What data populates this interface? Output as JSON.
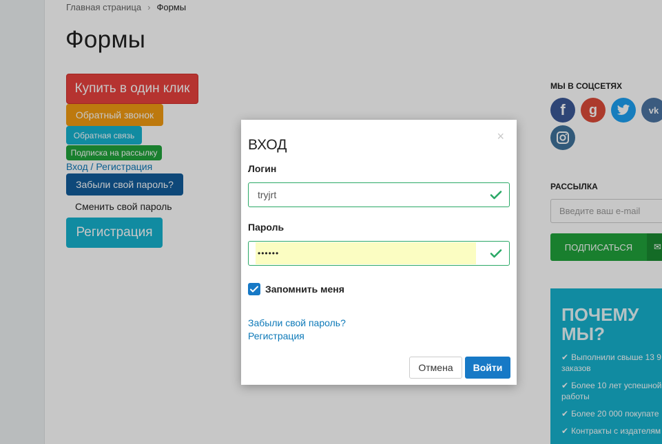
{
  "breadcrumb": {
    "home": "Главная страница",
    "separator": "›",
    "current": "Формы"
  },
  "page_title": "Формы",
  "buttons": {
    "buy_one_click": "Купить в один клик",
    "callback": "Обратный звонок",
    "feedback": "Обратная связь",
    "newsletter": "Подписка на рассылку",
    "login_register": "Вход / Регистрация",
    "forgot_password": "Забыли свой пароль?",
    "change_password": "Сменить свой пароль",
    "register": "Регистрация"
  },
  "sidebar": {
    "social_title": "МЫ В СОЦСЕТЯХ",
    "social": [
      {
        "name": "facebook-icon",
        "glyph": "f",
        "color": "#3b5998"
      },
      {
        "name": "google-plus-icon",
        "glyph": "g",
        "color": "#dd4b39"
      },
      {
        "name": "twitter-icon",
        "glyph": "t",
        "color": "#1da1f2"
      },
      {
        "name": "vk-icon",
        "glyph": "vk",
        "color": "#4c75a3"
      },
      {
        "name": "instagram-icon",
        "glyph": "◘",
        "color": "#3f729b"
      }
    ],
    "newsletter_title": "РАССЫЛКА",
    "email_placeholder": "Введите ваш e-mail",
    "subscribe_label": "ПОДПИСАТЬСЯ",
    "subscribe_icon": "✉",
    "why_title": "ПОЧЕМУ МЫ?",
    "why_items": [
      "Выполнили свыше 13 9",
      "заказов",
      "Более 10 лет успешной",
      "работы",
      "Более 20 000 покупате",
      "Контракты с издателям"
    ],
    "check_glyph": "✔"
  },
  "modal": {
    "title": "ВХОД",
    "close": "×",
    "login_label": "Логин",
    "login_value": "tryjrt",
    "password_label": "Пароль",
    "password_value": "••••••",
    "remember_label": "Запомнить меня",
    "remember_checked": true,
    "forgot_link": "Забыли свой пароль?",
    "register_link": "Регистрация",
    "cancel_label": "Отмена",
    "submit_label": "Войти",
    "accent_color": "#1779c6",
    "valid_color": "#2aa866"
  }
}
